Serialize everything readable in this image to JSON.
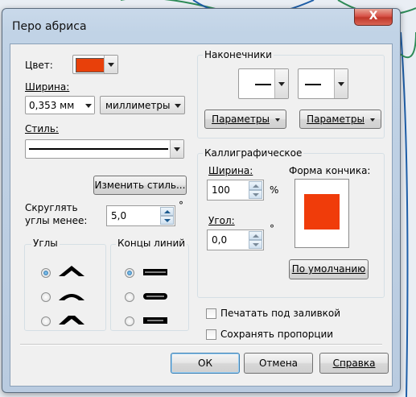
{
  "window": {
    "title": "Перо абриса",
    "close_glyph": "X"
  },
  "colors": {
    "outline_color": "#e8400a",
    "nib_preview": "#f03c0a",
    "accent": "#1c5b8f"
  },
  "color": {
    "label": "Цвет:"
  },
  "width": {
    "label": "Ширина:",
    "value": "0,353 мм",
    "units": "миллиметры"
  },
  "style": {
    "label": "Стиль:",
    "edit_button": "Изменить стиль..."
  },
  "round_corners": {
    "label_line1": "Скруглять",
    "label_line2": "углы менее:",
    "value": "5,0",
    "unit": "°"
  },
  "corners": {
    "title": "Углы",
    "options": [
      "miter-corner-icon",
      "round-corner-icon",
      "bevel-corner-icon"
    ],
    "selected": 0
  },
  "line_caps": {
    "title": "Концы линий",
    "options": [
      "butt-cap-icon",
      "round-cap-icon",
      "square-cap-icon"
    ],
    "selected": 0
  },
  "arrows": {
    "title": "Наконечники",
    "start_button": "Параметры",
    "end_button": "Параметры"
  },
  "calligraphy": {
    "title": "Каллиграфическое",
    "width_label": "Ширина:",
    "width_value": "100",
    "width_unit": "%",
    "angle_label": "Угол:",
    "angle_value": "0,0",
    "angle_unit": "°",
    "nib_label": "Форма кончика:",
    "default_button": "По умолчанию"
  },
  "options": {
    "behind_fill": "Печатать под заливкой",
    "scale_with_image": "Сохранять пропорции"
  },
  "buttons": {
    "ok": "ОК",
    "cancel": "Отмена",
    "help": "Справка"
  }
}
